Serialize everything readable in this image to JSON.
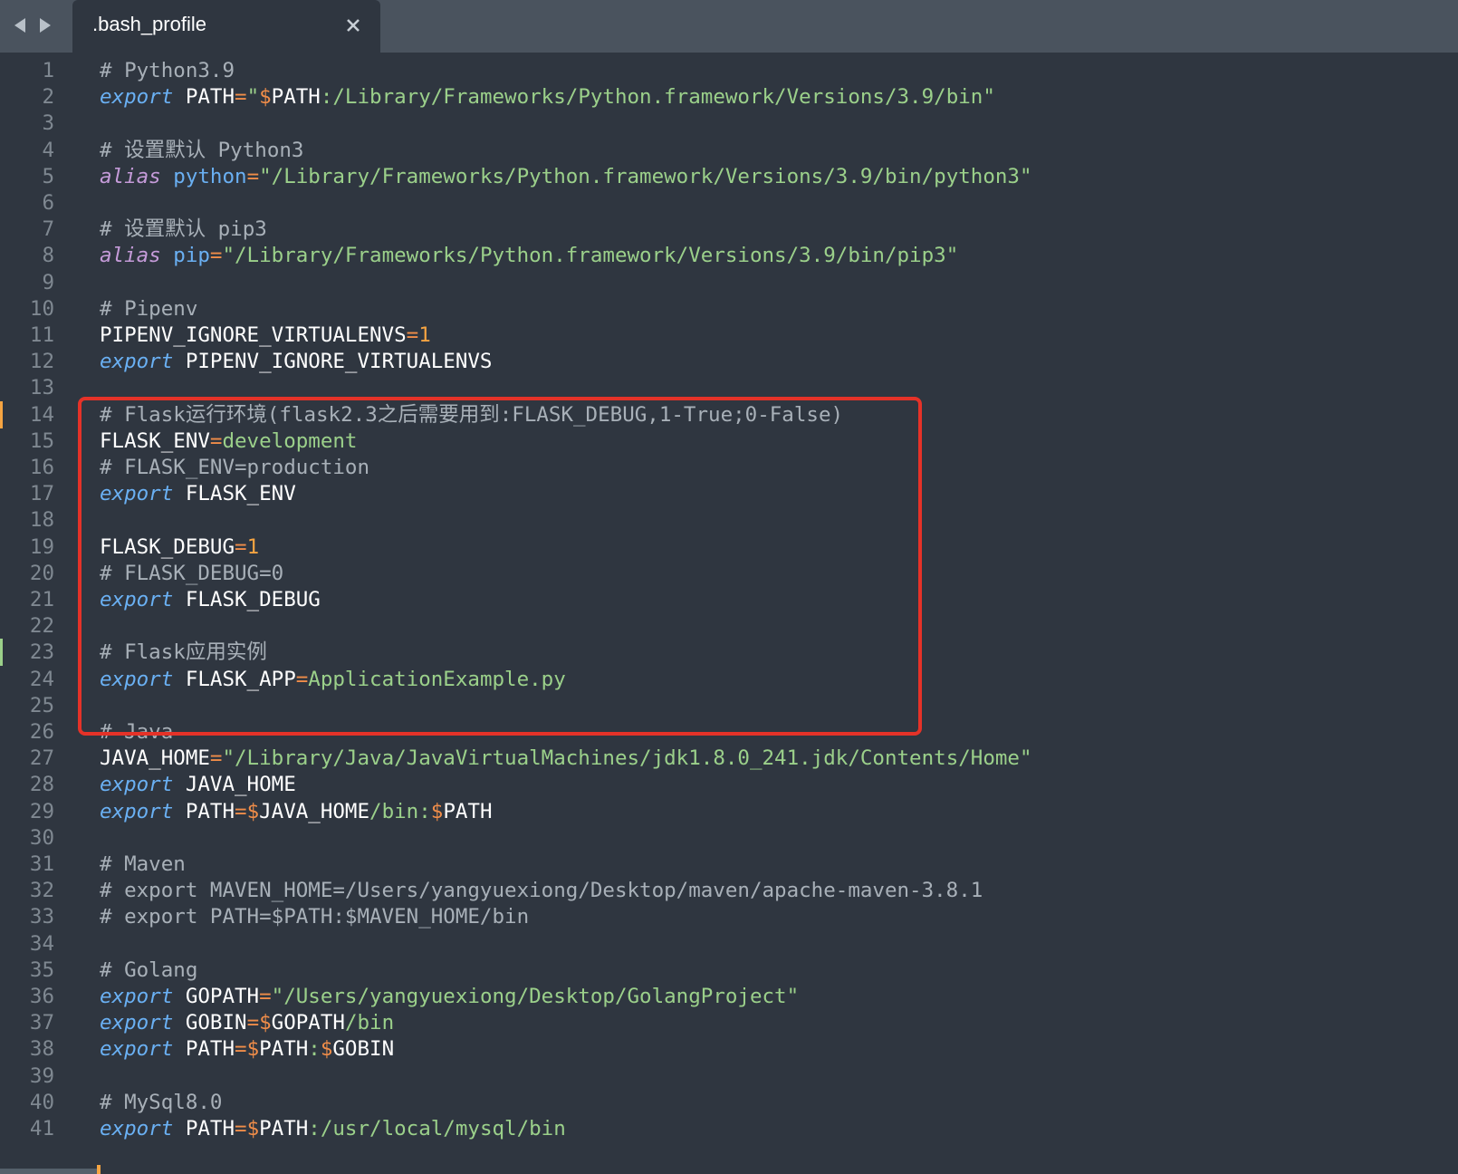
{
  "tab": {
    "title": ".bash_profile"
  },
  "lines": [
    [
      [
        "c",
        "# Python3.9"
      ]
    ],
    [
      [
        "k",
        "export"
      ],
      [
        "v",
        " PATH"
      ],
      [
        "o",
        "="
      ],
      [
        "s",
        "\""
      ],
      [
        "d",
        "$"
      ],
      [
        "v",
        "PATH"
      ],
      [
        "s",
        ":/Library/Frameworks/Python.framework/Versions/3.9/bin\""
      ]
    ],
    [],
    [
      [
        "c",
        "# 设置默认 Python3"
      ]
    ],
    [
      [
        "a",
        "alias"
      ],
      [
        "v",
        " "
      ],
      [
        "n",
        "python"
      ],
      [
        "o",
        "="
      ],
      [
        "s",
        "\"/Library/Frameworks/Python.framework/Versions/3.9/bin/python3\""
      ]
    ],
    [],
    [
      [
        "c",
        "# 设置默认 pip3"
      ]
    ],
    [
      [
        "a",
        "alias"
      ],
      [
        "v",
        " "
      ],
      [
        "n",
        "pip"
      ],
      [
        "o",
        "="
      ],
      [
        "s",
        "\"/Library/Frameworks/Python.framework/Versions/3.9/bin/pip3\""
      ]
    ],
    [],
    [
      [
        "c",
        "# Pipenv"
      ]
    ],
    [
      [
        "v",
        "PIPENV_IGNORE_VIRTUALENVS"
      ],
      [
        "o",
        "="
      ],
      [
        "u",
        "1"
      ]
    ],
    [
      [
        "k",
        "export"
      ],
      [
        "v",
        " PIPENV_IGNORE_VIRTUALENVS"
      ]
    ],
    [],
    [
      [
        "c",
        "# Flask运行环境(flask2.3之后需要用到:FLASK_DEBUG,1-True;0-False)"
      ]
    ],
    [
      [
        "v",
        "FLASK_ENV"
      ],
      [
        "o",
        "="
      ],
      [
        "s",
        "development"
      ]
    ],
    [
      [
        "c",
        "# FLASK_ENV=production"
      ]
    ],
    [
      [
        "k",
        "export"
      ],
      [
        "v",
        " FLASK_ENV"
      ]
    ],
    [],
    [
      [
        "v",
        "FLASK_DEBUG"
      ],
      [
        "o",
        "="
      ],
      [
        "u",
        "1"
      ]
    ],
    [
      [
        "c",
        "# FLASK_DEBUG=0"
      ]
    ],
    [
      [
        "k",
        "export"
      ],
      [
        "v",
        " FLASK_DEBUG"
      ]
    ],
    [],
    [
      [
        "c",
        "# Flask应用实例"
      ]
    ],
    [
      [
        "k",
        "export"
      ],
      [
        "v",
        " FLASK_APP"
      ],
      [
        "o",
        "="
      ],
      [
        "s",
        "ApplicationExample.py"
      ]
    ],
    [],
    [
      [
        "c",
        "# Java"
      ]
    ],
    [
      [
        "v",
        "JAVA_HOME"
      ],
      [
        "o",
        "="
      ],
      [
        "s",
        "\"/Library/Java/JavaVirtualMachines/jdk1.8.0_241.jdk/Contents/Home\""
      ]
    ],
    [
      [
        "k",
        "export"
      ],
      [
        "v",
        " JAVA_HOME"
      ]
    ],
    [
      [
        "k",
        "export"
      ],
      [
        "v",
        " PATH"
      ],
      [
        "o",
        "="
      ],
      [
        "d",
        "$"
      ],
      [
        "v",
        "JAVA_HOME"
      ],
      [
        "s",
        "/bin:"
      ],
      [
        "d",
        "$"
      ],
      [
        "v",
        "PATH"
      ]
    ],
    [],
    [
      [
        "c",
        "# Maven"
      ]
    ],
    [
      [
        "c",
        "# export MAVEN_HOME=/Users/yangyuexiong/Desktop/maven/apache-maven-3.8.1"
      ]
    ],
    [
      [
        "c",
        "# export PATH=$PATH:$MAVEN_HOME/bin"
      ]
    ],
    [],
    [
      [
        "c",
        "# Golang"
      ]
    ],
    [
      [
        "k",
        "export"
      ],
      [
        "v",
        " GOPATH"
      ],
      [
        "o",
        "="
      ],
      [
        "s",
        "\"/Users/yangyuexiong/Desktop/GolangProject\""
      ]
    ],
    [
      [
        "k",
        "export"
      ],
      [
        "v",
        " GOBIN"
      ],
      [
        "o",
        "="
      ],
      [
        "d",
        "$"
      ],
      [
        "v",
        "GOPATH"
      ],
      [
        "s",
        "/bin"
      ]
    ],
    [
      [
        "k",
        "export"
      ],
      [
        "v",
        " PATH"
      ],
      [
        "o",
        "="
      ],
      [
        "d",
        "$"
      ],
      [
        "v",
        "PATH"
      ],
      [
        "s",
        ":"
      ],
      [
        "d",
        "$"
      ],
      [
        "v",
        "GOBIN"
      ]
    ],
    [],
    [
      [
        "c",
        "# MySql8.0"
      ]
    ],
    [
      [
        "k",
        "export"
      ],
      [
        "v",
        " PATH"
      ],
      [
        "o",
        "="
      ],
      [
        "d",
        "$"
      ],
      [
        "v",
        "PATH"
      ],
      [
        "s",
        ":/usr/local/mysql/bin"
      ]
    ]
  ],
  "gutter_marks": [
    {
      "line": 14,
      "color": "#f5a442"
    },
    {
      "line": 23,
      "color": "#9bd08a"
    }
  ],
  "colors": {
    "background": "#2f3640",
    "tabbar": "#4a535e",
    "highlight_border": "#e53228"
  },
  "icons": {
    "back": "triangle-left",
    "forward": "triangle-right",
    "close": "x"
  }
}
